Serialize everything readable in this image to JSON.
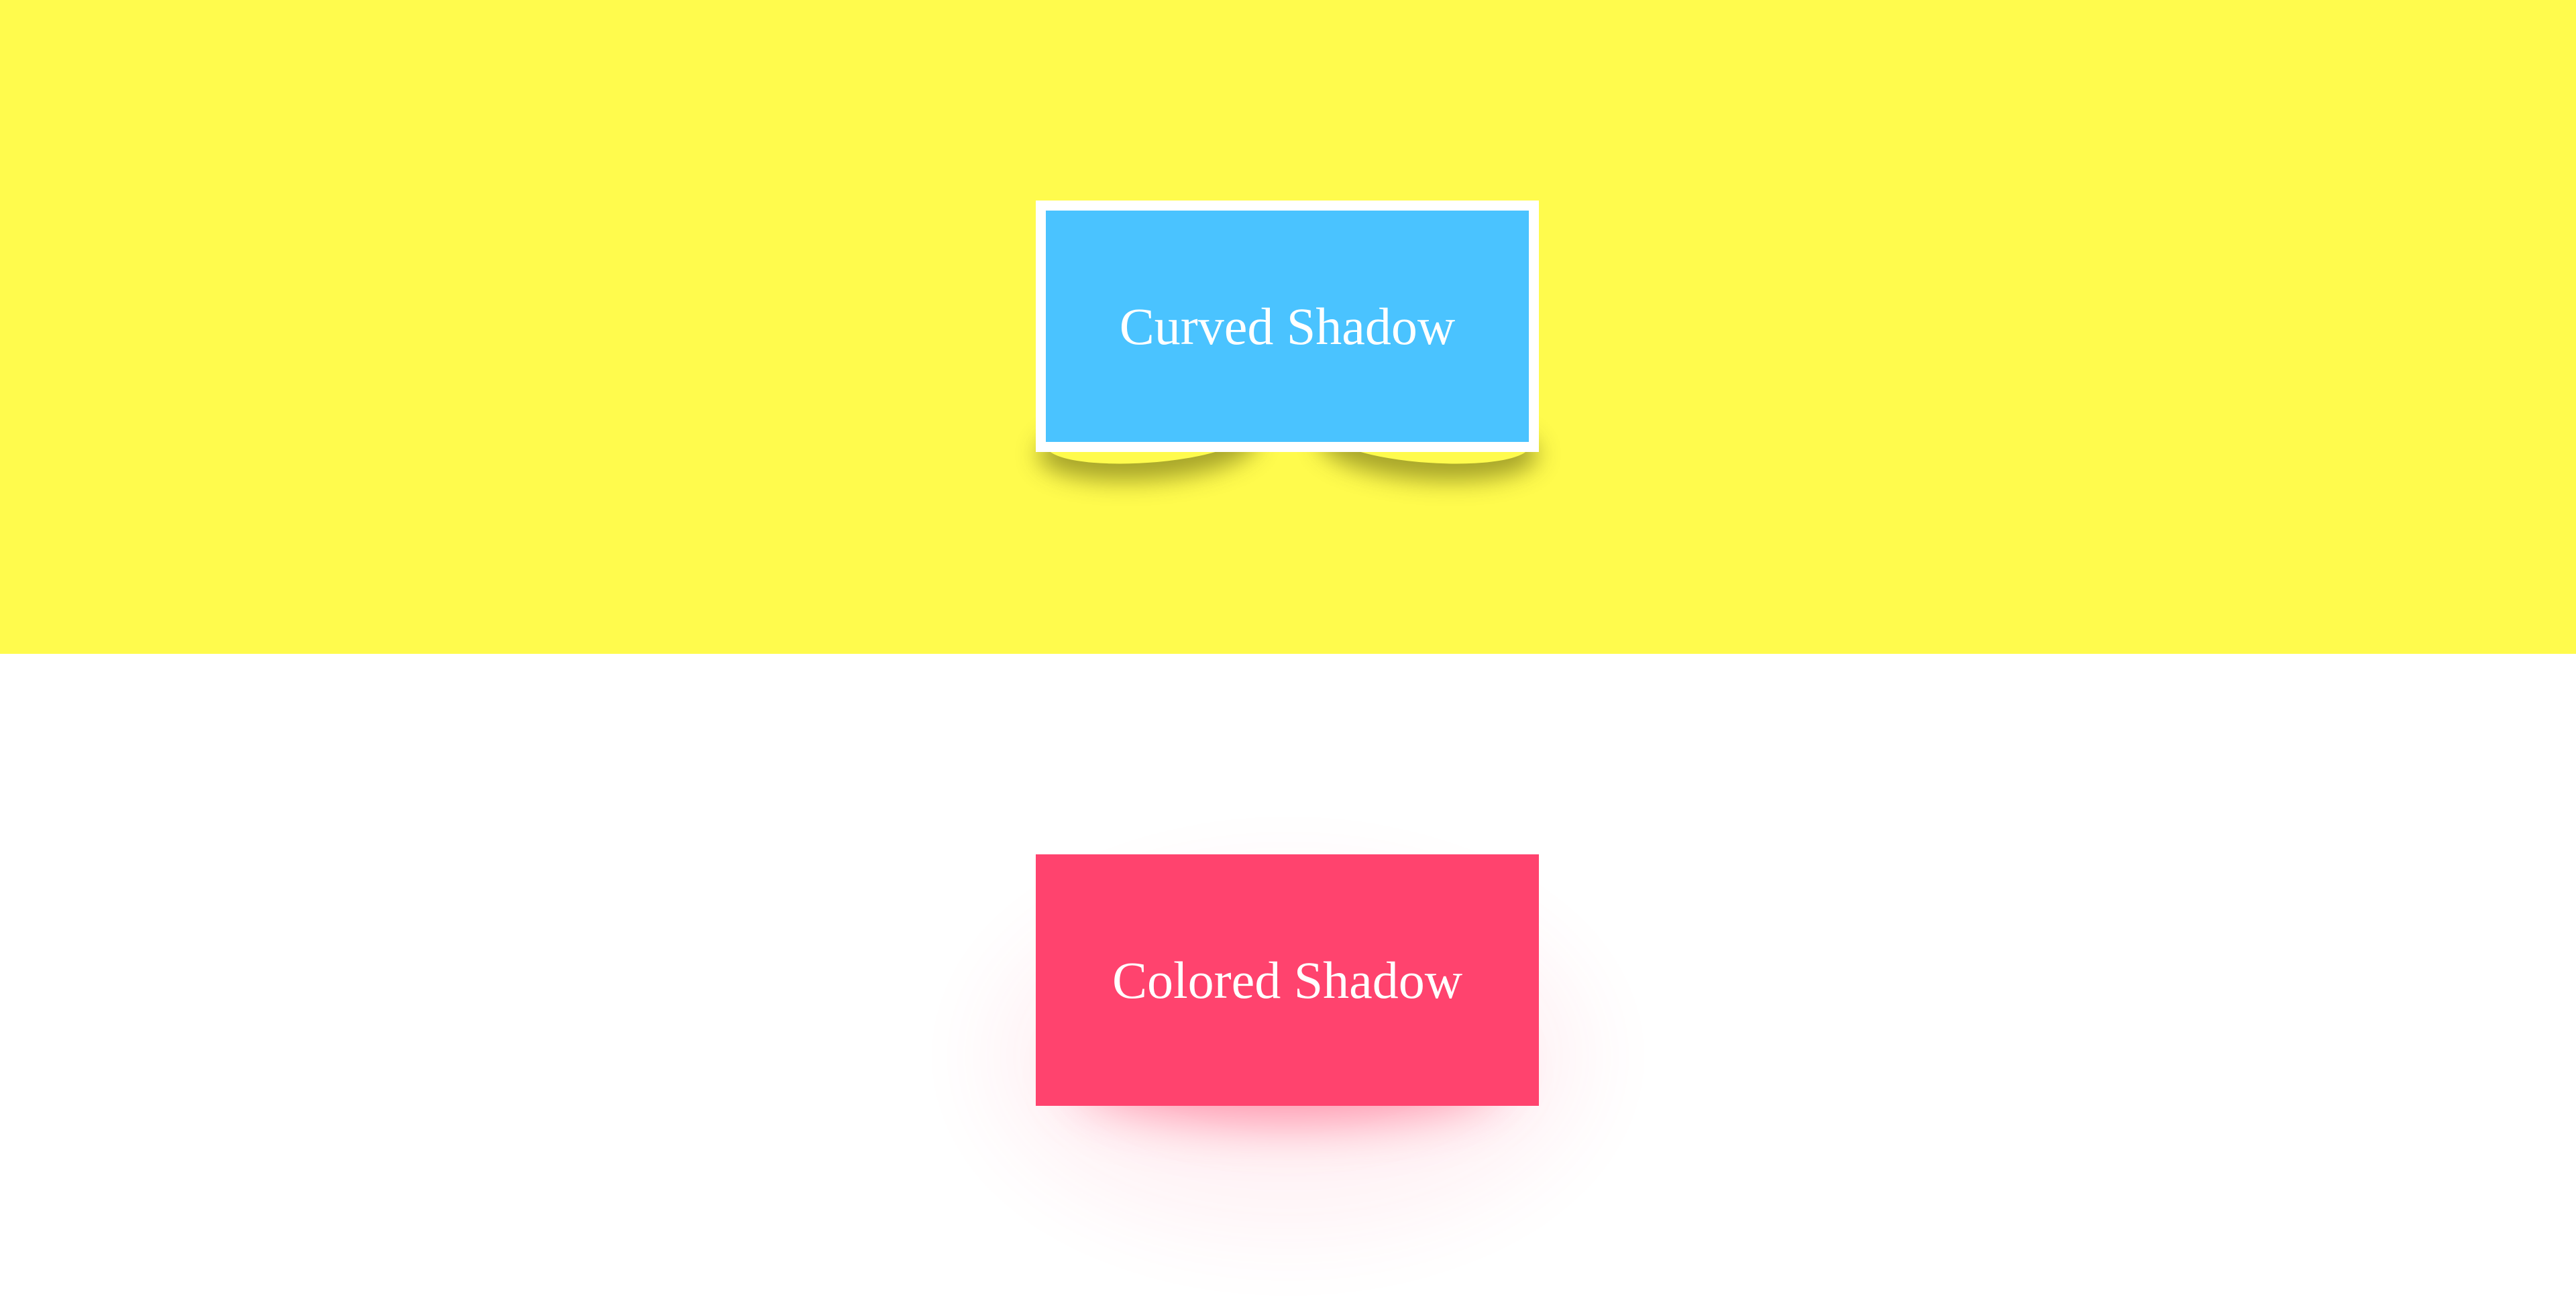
{
  "colors": {
    "top_background": "#fffb4d",
    "bottom_background": "#ffffff",
    "curved_card_fill": "#4ac3ff",
    "colored_card_fill": "#ff436e",
    "colored_shadow": "#ff436e"
  },
  "curved_card": {
    "label": "Curved Shadow"
  },
  "colored_card": {
    "label": "Colored Shadow"
  }
}
